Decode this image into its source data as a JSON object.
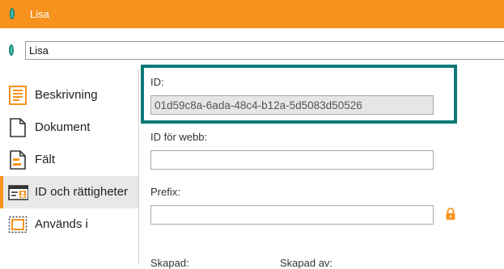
{
  "window": {
    "title": "Lisa"
  },
  "name_field": {
    "value": "Lisa"
  },
  "sidebar": {
    "items": [
      {
        "label": "Beskrivning",
        "icon": "description-icon"
      },
      {
        "label": "Dokument",
        "icon": "document-icon"
      },
      {
        "label": "Fält",
        "icon": "fields-icon"
      },
      {
        "label": "ID och rättigheter",
        "icon": "id-card-icon",
        "active": true
      },
      {
        "label": "Används i",
        "icon": "used-in-icon"
      }
    ]
  },
  "form": {
    "id_label": "ID:",
    "id_value": "01d59c8a-6ada-48c4-b12a-5d5083d50526",
    "web_id_label": "ID för webb:",
    "web_id_value": "",
    "prefix_label": "Prefix:",
    "prefix_value": "",
    "created_label": "Skapad:",
    "created_by_label": "Skapad av:"
  },
  "colors": {
    "accent": "#f7921e",
    "highlight": "#0e7a78"
  }
}
